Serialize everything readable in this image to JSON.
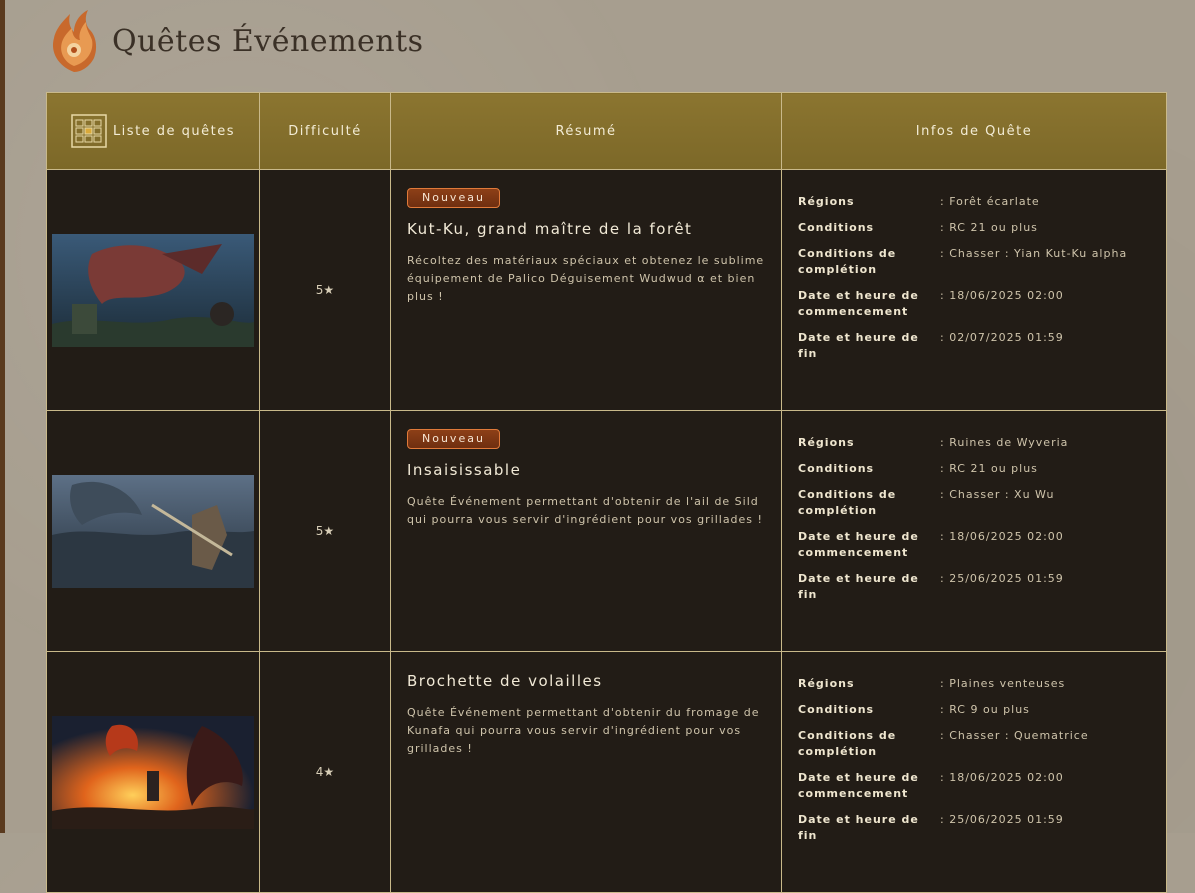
{
  "page": {
    "title": "Quêtes Événements"
  },
  "table": {
    "headers": {
      "list": "Liste de quêtes",
      "difficulty": "Difficulté",
      "summary": "Résumé",
      "info": "Infos de Quête"
    },
    "info_labels": {
      "regions": "Régions",
      "conditions": "Conditions",
      "completion": "Conditions de complétion",
      "start": "Date et heure de commencement",
      "end": "Date et heure de fin"
    },
    "rows": [
      {
        "badge": "Nouveau",
        "difficulty": "5★",
        "name": "Kut-Ku, grand maître de la forêt",
        "description": "Récoltez des matériaux spéciaux et obtenez le sublime équipement de Palico Déguisement Wudwud α et bien plus !",
        "regions": ": Forêt écarlate",
        "conditions": ": RC 21 ou plus",
        "completion": ": Chasser : Yian Kut-Ku alpha",
        "start": ": 18/06/2025 02:00",
        "end": ": 02/07/2025 01:59"
      },
      {
        "badge": "Nouveau",
        "difficulty": "5★",
        "name": "Insaisissable",
        "description": "Quête Événement permettant d'obtenir de l'ail de Sild qui pourra vous servir d'ingrédient pour vos grillades !",
        "regions": ": Ruines de Wyveria",
        "conditions": ": RC 21 ou plus",
        "completion": ": Chasser : Xu Wu",
        "start": ": 18/06/2025 02:00",
        "end": ": 25/06/2025 01:59"
      },
      {
        "badge": "",
        "difficulty": "4★",
        "name": "Brochette de volailles",
        "description": "Quête Événement permettant d'obtenir du fromage de Kunafa qui pourra vous servir d'ingrédient pour vos grillades !",
        "regions": ": Plaines venteuses",
        "conditions": ": RC 9 ou plus",
        "completion": ": Chasser : Quematrice",
        "start": ": 18/06/2025 02:00",
        "end": ": 25/06/2025 01:59"
      }
    ]
  }
}
